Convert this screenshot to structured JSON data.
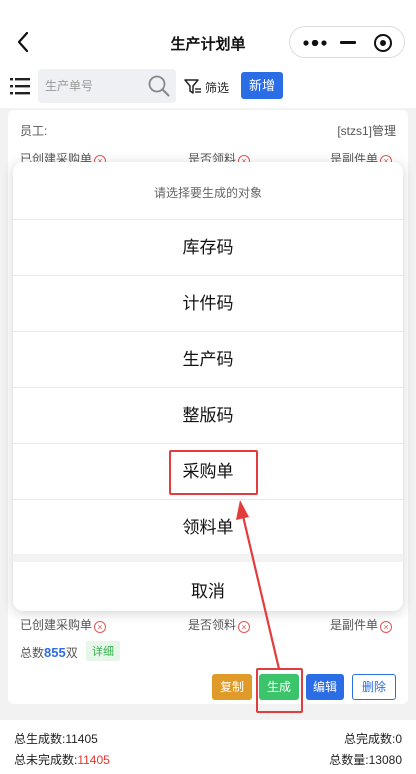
{
  "navbar": {
    "title": "生产计划单",
    "back_icon": "chevron-left-icon",
    "more_icon": "more-dots-icon",
    "minimize_icon": "minimize-icon",
    "close_icon": "target-circle-icon"
  },
  "toolbar": {
    "menu_icon": "list-menu-icon",
    "search_placeholder": "生产单号",
    "search_icon": "search-icon",
    "filter_icon": "filter-icon",
    "filter_label": "筛选",
    "new_label": "新增"
  },
  "card": {
    "employee_label": "员工:",
    "employee_value": "[stzs1]管理",
    "purchase_created": "已创建采购单",
    "material_picked": "是否领料",
    "sub_item": "是副件单",
    "total_prefix": "总数",
    "total_value": "855",
    "total_unit": "双",
    "detail_label": "详细",
    "actions": {
      "copy": "复制",
      "generate": "生成",
      "edit": "编辑",
      "delete": "删除"
    }
  },
  "action_sheet": {
    "title": "请选择要生成的对象",
    "options": [
      "库存码",
      "计件码",
      "生产码",
      "整版码",
      "采购单",
      "领料单"
    ],
    "cancel": "取消"
  },
  "summary": {
    "generated_label": "总生成数:",
    "generated_value": "11405",
    "completed_label": "总完成数:",
    "completed_value": "0",
    "uncompleted_label": "总未完成数:",
    "uncompleted_value": "11405",
    "quantity_label": "总数量:",
    "quantity_value": "13080"
  },
  "colors": {
    "primary": "#2b6de5",
    "copy": "#e09a2a",
    "generate": "#3cc46a",
    "edit": "#2b6de5",
    "annotation": "#e23c3c",
    "uncompleted": "#e5352b"
  }
}
